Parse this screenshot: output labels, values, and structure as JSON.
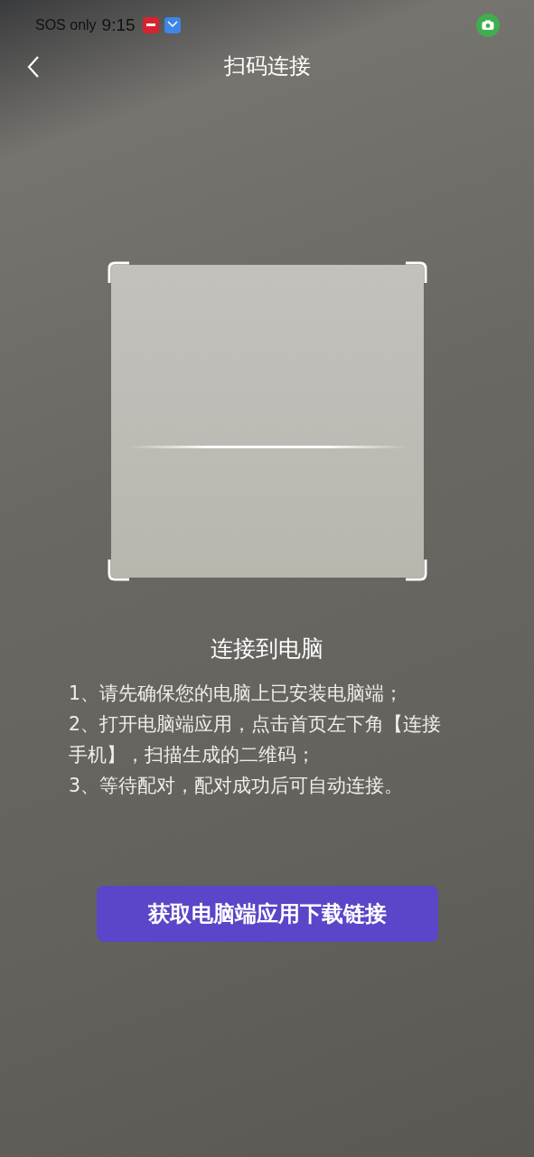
{
  "status_bar": {
    "carrier": "SOS only",
    "time": "9:15"
  },
  "header": {
    "title": "扫码连接"
  },
  "scanner": {
    "heading": "连接到电脑"
  },
  "instructions": [
    "1、请先确保您的电脑上已安装电脑端；",
    "2、打开电脑端应用，点击首页左下角【连接手机】，扫描生成的二维码；",
    "3、等待配对，配对成功后可自动连接。"
  ],
  "button": {
    "label": "获取电脑端应用下载链接"
  }
}
